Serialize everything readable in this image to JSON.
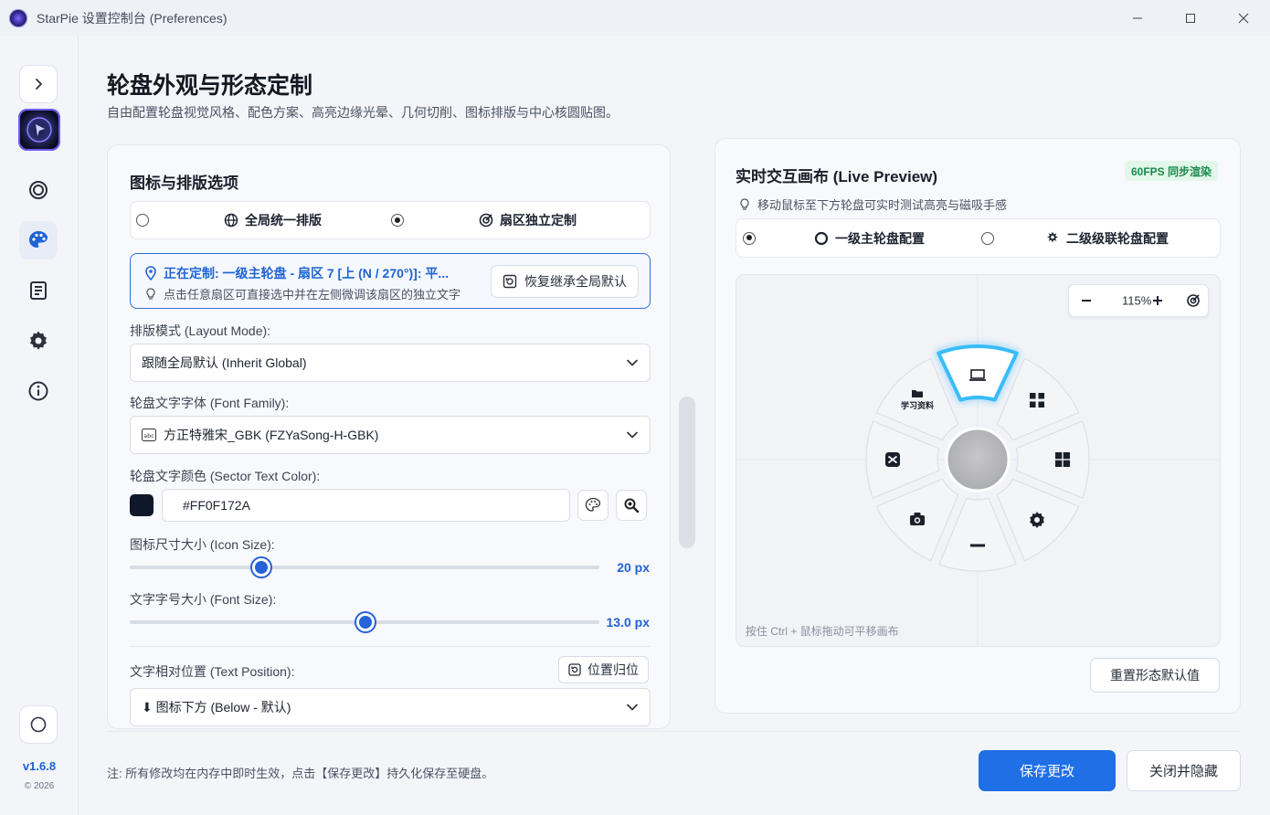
{
  "window": {
    "title": "StarPie 设置控制台 (Preferences)",
    "minimize": "—",
    "maximize": "☐",
    "close": "✕"
  },
  "sidebar": {
    "version": "v1.6.8",
    "year": "© 2026",
    "items": [
      {
        "icon": "chevron-right-icon"
      },
      {
        "icon": "ring-icon"
      },
      {
        "icon": "palette-icon"
      },
      {
        "icon": "document-icon"
      },
      {
        "icon": "gear-icon"
      },
      {
        "icon": "info-icon"
      }
    ]
  },
  "header": {
    "title": "轮盘外观与形态定制",
    "subtitle": "自由配置轮盘视觉风格、配色方案、高亮边缘光晕、几何切削、图标排版与中心核圆贴图。"
  },
  "left": {
    "title": "图标与排版选项",
    "mode_options": [
      {
        "label": "全局统一排版",
        "selected": false
      },
      {
        "label": "扇区独立定制",
        "selected": true
      }
    ],
    "info": {
      "line1": "正在定制: 一级主轮盘 - 扇区 7 [上 (N / 270°)]: 平...",
      "line2": "点击任意扇区可直接选中并在左侧微调该扇区的独立文字",
      "restore_button": "恢复继承全局默认"
    },
    "layout_mode": {
      "label": "排版模式 (Layout Mode):",
      "value": "跟随全局默认 (Inherit Global)"
    },
    "font_family": {
      "label": "轮盘文字字体 (Font Family):",
      "value": "方正特雅宋_GBK (FZYaSong-H-GBK)"
    },
    "text_color": {
      "label": "轮盘文字颜色 (Sector Text Color):",
      "value": "#FF0F172A",
      "swatch": "#0f172a"
    },
    "icon_size": {
      "label": "图标尺寸大小 (Icon Size):",
      "value": "20 px",
      "fraction": 0.28
    },
    "font_size": {
      "label": "文字字号大小 (Font Size):",
      "value": "13.0 px",
      "fraction": 0.502
    },
    "text_position": {
      "label": "文字相对位置 (Text Position):",
      "reset_button": "位置归位",
      "value": "⬇ 图标下方 (Below - 默认)"
    }
  },
  "right": {
    "title": "实时交互画布 (Live Preview)",
    "fps_badge": "60FPS 同步渲染",
    "hint": "移动鼠标至下方轮盘可实时测试高亮与磁吸手感",
    "wheel_options": [
      {
        "label": "一级主轮盘配置",
        "selected": true
      },
      {
        "label": "二级级联轮盘配置",
        "selected": false
      }
    ],
    "zoom": {
      "level": "115%",
      "minus": "−",
      "plus": "+"
    },
    "canvas_hint": "按住 Ctrl + 鼠标拖动可平移画布",
    "sector_label": "学习资料",
    "reset_button": "重置形态默认值",
    "accent": "#38bdf8"
  },
  "footer": {
    "note": "注: 所有修改均在内存中即时生效，点击【保存更改】持久化保存至硬盘。",
    "save": "保存更改",
    "close": "关闭并隐藏"
  }
}
